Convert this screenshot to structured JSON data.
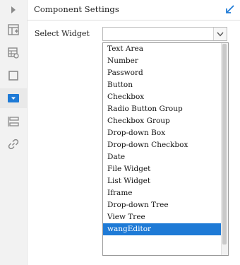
{
  "panel": {
    "title": "Component Settings"
  },
  "field": {
    "label": "Select Widget",
    "value": ""
  },
  "dropdown": {
    "options": [
      "Text Area",
      "Number",
      "Password",
      "Button",
      "Checkbox",
      "Radio Button Group",
      "Checkbox Group",
      "Drop-down Box",
      "Drop-down Checkbox",
      "Date",
      "File Widget",
      "List Widget",
      "Iframe",
      "Drop-down Tree",
      "View Tree",
      "wangEditor"
    ],
    "highlighted": "wangEditor"
  },
  "rail": {
    "icons": [
      "expand-arrow-icon",
      "table-layout-icon",
      "table-settings-icon",
      "frame-icon",
      "dropdown-widget-icon",
      "list-stack-icon",
      "link-icon"
    ],
    "active": "dropdown-widget-icon"
  },
  "colors": {
    "accent": "#1e7ad6",
    "rail_background": "#f2f2f2",
    "icon_gray": "#8a8a8a"
  }
}
